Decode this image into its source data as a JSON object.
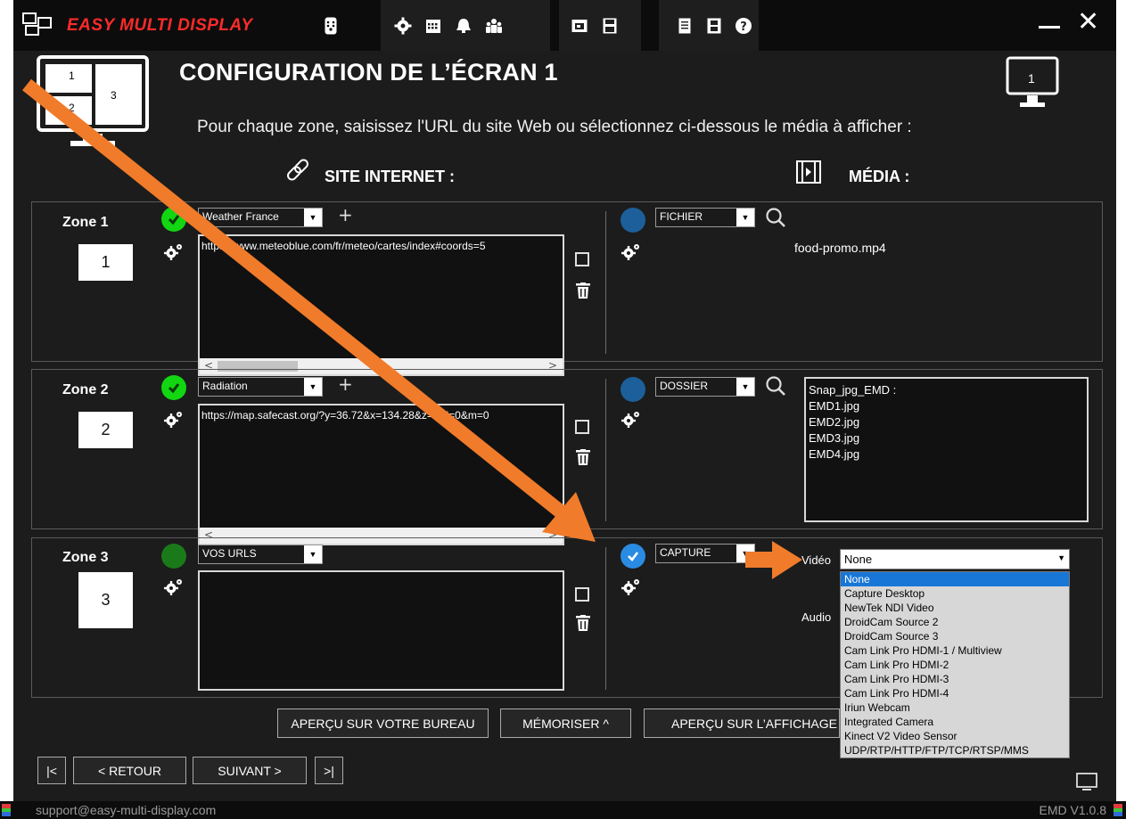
{
  "app": {
    "logo_text": "EASY MULTI DISPLAY",
    "brand_color": "#ff2a2a",
    "window_controls": {
      "minimize": "—",
      "close": "✕"
    }
  },
  "toolbar_icons": [
    "remote-icon",
    "gear-icon",
    "calendar-icon",
    "alarm-icon",
    "group-icon",
    "folder-icon",
    "save-icon",
    "document-icon",
    "film-icon",
    "help-icon"
  ],
  "header": {
    "title": "CONFIGURATION DE L’ÉCRAN 1",
    "subtitle": "Pour chaque zone, saisissez l'URL du site Web ou sélectionnez ci-dessous le média à afficher :",
    "screen_number": "1",
    "layout_thumb": [
      "1",
      "3",
      "2"
    ],
    "site_heading": "SITE INTERNET :",
    "media_heading": "MÉDIA :"
  },
  "zones": [
    {
      "label": "Zone 1",
      "number": "1",
      "site_combo": "Weather France",
      "url": "https://www.meteoblue.com/fr/meteo/cartes/index#coords=5",
      "media_combo": "FICHIER",
      "media_value": "food-promo.mp4"
    },
    {
      "label": "Zone 2",
      "number": "2",
      "site_combo": "Radiation",
      "url": "https://map.safecast.org/?y=36.72&x=134.28&z=7&l=0&m=0",
      "media_combo": "DOSSIER",
      "media_list": [
        "Snap_jpg_EMD :",
        "EMD1.jpg",
        "EMD2.jpg",
        "EMD3.jpg",
        "EMD4.jpg"
      ]
    },
    {
      "label": "Zone 3",
      "number": "3",
      "site_combo": "VOS URLS",
      "url": "",
      "media_combo": "CAPTURE",
      "video_label": "Vidéo",
      "audio_label": "Audio",
      "video_selected": "None",
      "video_options": [
        "None",
        "Capture Desktop",
        "NewTek NDI Video",
        "DroidCam Source 2",
        "DroidCam Source 3",
        "Cam Link Pro HDMI-1 / Multiview",
        "Cam Link Pro HDMI-2",
        "Cam Link Pro HDMI-3",
        "Cam Link Pro HDMI-4",
        "Iriun Webcam",
        "Integrated Camera",
        "Kinect V2 Video Sensor",
        "UDP/RTP/HTTP/FTP/TCP/RTSP/MMS"
      ]
    }
  ],
  "buttons": {
    "preview_desktop": "APERÇU SUR VOTRE BUREAU",
    "memorize": "MÉMORISER ^",
    "preview_display": "APERÇU SUR L’AFFICHAGE"
  },
  "nav": {
    "first": "|<",
    "back": "< RETOUR",
    "next": "SUIVANT >",
    "last": ">|"
  },
  "footer": {
    "email": "support@easy-multi-display.com",
    "version": "EMD V1.0.8"
  },
  "colors": {
    "annotation_arrow": "#f07b2a",
    "ok_green": "#11d611",
    "selected_blue": "#2a8be3",
    "highlight": "#1876d7"
  }
}
